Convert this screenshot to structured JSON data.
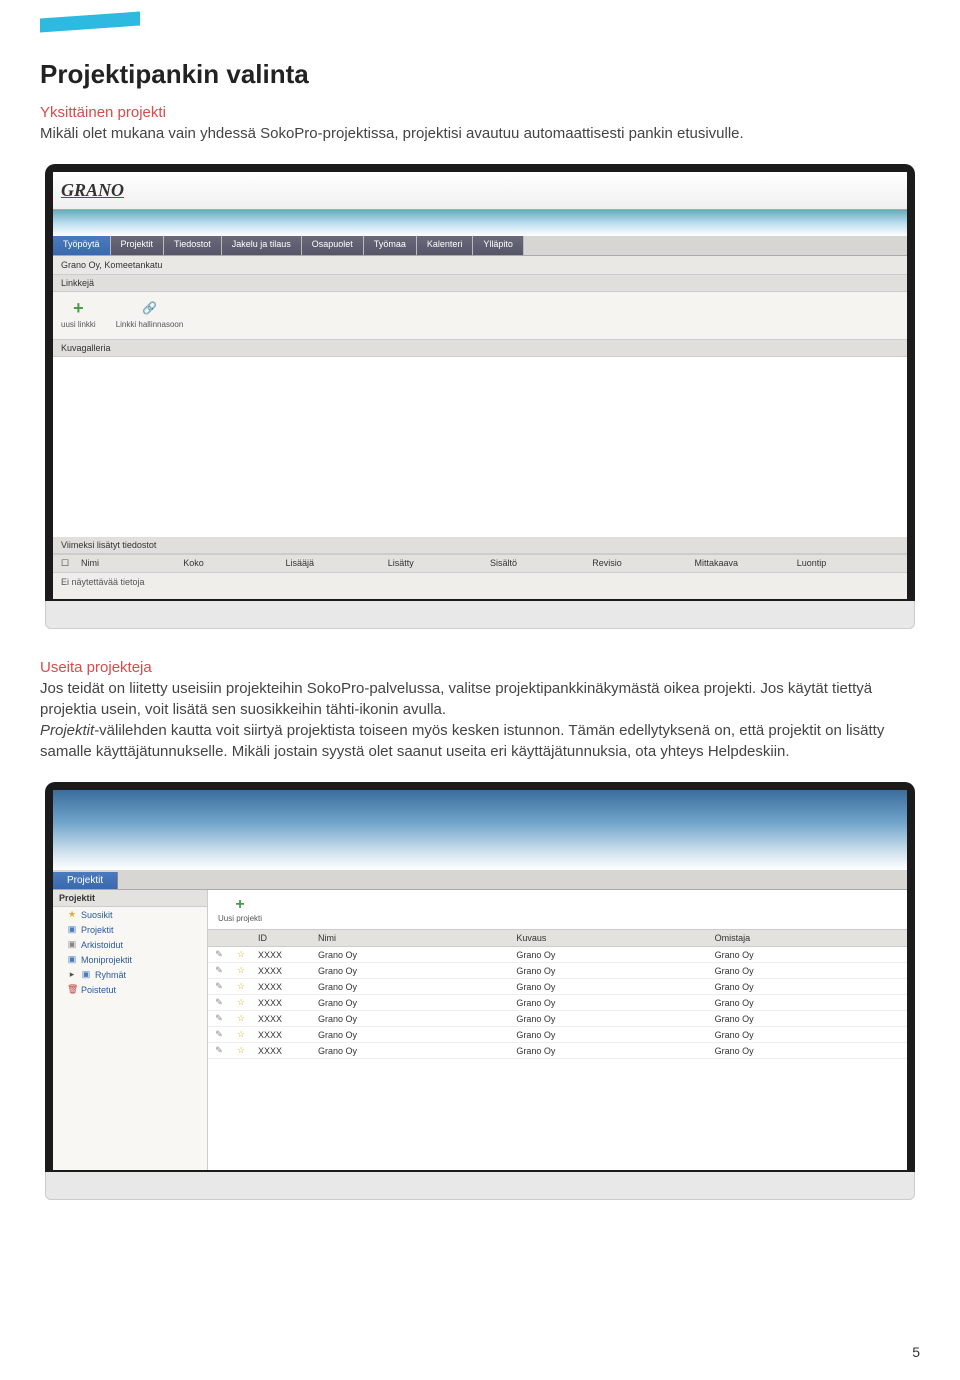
{
  "accent_color": "#2eb9e0",
  "title": "Projektipankin valinta",
  "section1": {
    "subtitle": "Yksittäinen projekti",
    "body": "Mikäli olet mukana vain yhdessä SokoPro-projektissa, projektisi avautuu automaattisesti pankin etusivulle."
  },
  "screenshot1": {
    "logo": "GRANO",
    "tabs": [
      "Työpöytä",
      "Projektit",
      "Tiedostot",
      "Jakelu ja tilaus",
      "Osapuolet",
      "Työmaa",
      "Kalenteri",
      "Ylläpito"
    ],
    "active_tab_index": 0,
    "breadcrumb": "Grano Oy, Komeetankatu",
    "section_links": "Linkkejä",
    "toolbar": {
      "add_link": "uusi linkki",
      "manage_links": "Linkki hallinnasoon"
    },
    "section_gallery": "Kuvagalleria",
    "section_recent": "Viimeksi lisätyt tiedostot",
    "table_headers": [
      "",
      "Nimi",
      "Koko",
      "Lisääjä",
      "Lisätty",
      "Sisältö",
      "Revisio",
      "Mittakaava",
      "Luontip"
    ],
    "no_data": "Ei näytettävää tietoja"
  },
  "section2": {
    "subtitle": "Useita projekteja",
    "body1": "Jos teidät on liitetty useisiin projekteihin SokoPro-palvelussa, valitse projektipankkinäkymästä oikea projekti. Jos käytät tiettyä projektia usein, voit lisätä sen suosikkeihin tähti-ikonin avulla.",
    "body2_prefix_italic": "Projektit",
    "body2_rest": "-välilehden kautta voit siirtyä projektista toiseen myös kesken istunnon. Tämän edellytyksenä on, että projektit on lisätty samalle käyttäjätunnukselle. Mikäli jostain syystä olet saanut useita eri käyttäjätunnuksia, ota yhteys Helpdeskiin."
  },
  "screenshot2": {
    "tab": "Projektit",
    "sidebar_header": "Projektit",
    "sidebar_items": [
      {
        "icon": "star",
        "label": "Suosikit"
      },
      {
        "icon": "folder-blue",
        "label": "Projektit"
      },
      {
        "icon": "folder-gray",
        "label": "Arkistoidut"
      },
      {
        "icon": "folder-blue",
        "label": "Moniprojektit"
      },
      {
        "icon": "folder-blue",
        "label": "Ryhmät",
        "expand": true
      },
      {
        "icon": "trash",
        "label": "Poistetut"
      }
    ],
    "new_project": "Uusi projekti",
    "table_headers": [
      "",
      "",
      "ID",
      "Nimi",
      "Kuvaus",
      "Omistaja"
    ],
    "rows": [
      {
        "id": "XXXX",
        "name": "Grano Oy",
        "desc": "Grano Oy",
        "owner": "Grano Oy"
      },
      {
        "id": "XXXX",
        "name": "Grano Oy",
        "desc": "Grano Oy",
        "owner": "Grano Oy"
      },
      {
        "id": "XXXX",
        "name": "Grano Oy",
        "desc": "Grano Oy",
        "owner": "Grano Oy"
      },
      {
        "id": "XXXX",
        "name": "Grano Oy",
        "desc": "Grano Oy",
        "owner": "Grano Oy"
      },
      {
        "id": "XXXX",
        "name": "Grano Oy",
        "desc": "Grano Oy",
        "owner": "Grano Oy"
      },
      {
        "id": "XXXX",
        "name": "Grano Oy",
        "desc": "Grano Oy",
        "owner": "Grano Oy"
      },
      {
        "id": "XXXX",
        "name": "Grano Oy",
        "desc": "Grano Oy",
        "owner": "Grano Oy"
      }
    ]
  },
  "page_number": "5"
}
